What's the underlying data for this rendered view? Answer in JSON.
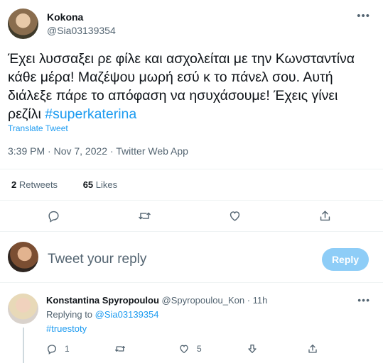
{
  "tweet": {
    "display_name": "Kokona",
    "handle": "@Sia03139354",
    "more_icon": "more-dots-icon",
    "text_main": "Έχει λυσσαξει ρε φίλε και ασχολείται με την Κωνσταντίνα κάθε μέρα! Μαζέψου μωρή εσύ κ το πάνελ σου. Αυτή διάλεξε πάρε το απόφαση να ησυχάσουμε! Έχεις γίνει ρεζίλι ",
    "hashtag": "#superkaterina",
    "translate_label": "Translate Tweet",
    "timestamp": "3:39 PM · Nov 7, 2022 · Twitter Web App",
    "retweets_count": "2",
    "retweets_label": "Retweets",
    "likes_count": "65",
    "likes_label": "Likes",
    "actions": [
      "reply-icon",
      "retweet-icon",
      "like-icon",
      "share-icon"
    ]
  },
  "reply_box": {
    "placeholder": "Tweet your reply",
    "button_label": "Reply"
  },
  "reply_tweet": {
    "display_name": "Konstantina Spyropoulou",
    "handle": "@Spyropoulou_Kon",
    "separator": "·",
    "time": "11h",
    "replying_prefix": "Replying to",
    "replying_to": "@Sia03139354",
    "text": "#truestoty",
    "reply_count": "1",
    "like_count": "5"
  },
  "colors": {
    "accent": "#1d9bf0",
    "muted_text": "#536471",
    "reply_button_disabled": "#8ecdf7",
    "divider": "#eff3f4"
  }
}
